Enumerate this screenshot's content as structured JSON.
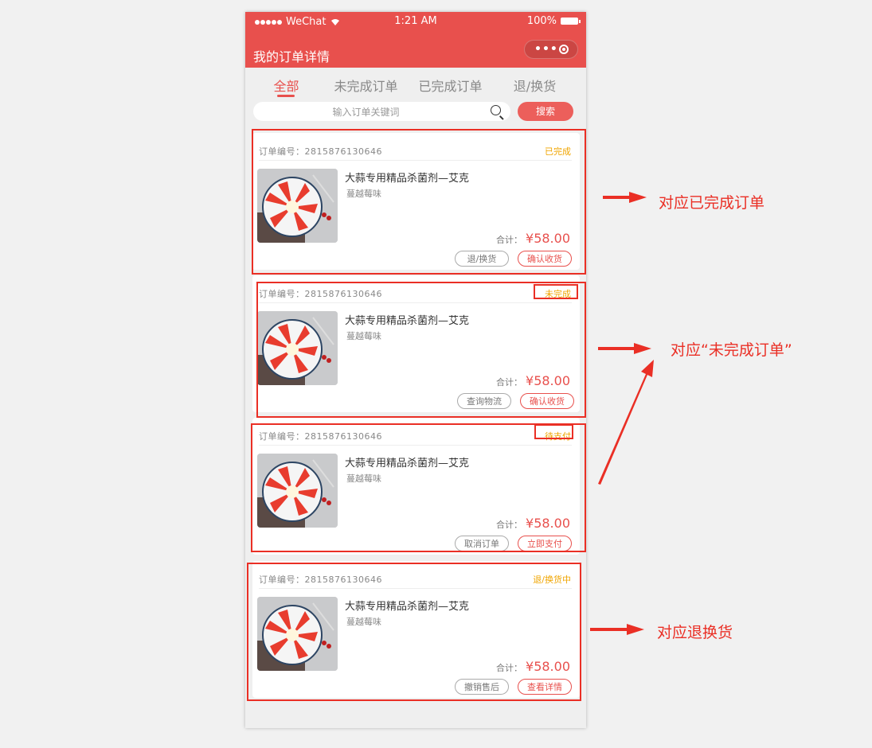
{
  "status_bar": {
    "carrier": "WeChat",
    "time": "1:21 AM",
    "battery": "100%"
  },
  "navbar": {
    "title": "我的订单详情"
  },
  "tabs": [
    "全部",
    "未完成订单",
    "已完成订单",
    "退/换货"
  ],
  "search": {
    "placeholder": "输入订单关键词",
    "button": "搜索"
  },
  "orders": [
    {
      "order_label": "订单编号：2815876130646",
      "status": "已完成",
      "name": "大蒜专用精品杀菌剂—艾克",
      "spec": "蔓越莓味",
      "total_label": "合计：",
      "price": "¥58.00",
      "btn1": "退/换货",
      "btn2": "确认收货"
    },
    {
      "order_label": "订单编号：2815876130646",
      "status": "未完成",
      "name": "大蒜专用精品杀菌剂—艾克",
      "spec": "蔓越莓味",
      "total_label": "合计：",
      "price": "¥58.00",
      "btn1": "查询物流",
      "btn2": "确认收货"
    },
    {
      "order_label": "订单编号：2815876130646",
      "status": "待支付",
      "name": "大蒜专用精品杀菌剂—艾克",
      "spec": "蔓越莓味",
      "total_label": "合计：",
      "price": "¥58.00",
      "btn1": "取消订单",
      "btn2": "立即支付"
    },
    {
      "order_label": "订单编号：2815876130646",
      "status": "退/换货中",
      "name": "大蒜专用精品杀菌剂—艾克",
      "spec": "蔓越莓味",
      "total_label": "合计：",
      "price": "¥58.00",
      "btn1": "撤销售后",
      "btn2": "查看详情"
    }
  ],
  "annotations": [
    "对应已完成订单",
    "对应“未完成订单”",
    "对应退换货"
  ],
  "colors": {
    "brand": "#e8504d",
    "status": "#f0a500",
    "annotation": "#ea2f25"
  }
}
